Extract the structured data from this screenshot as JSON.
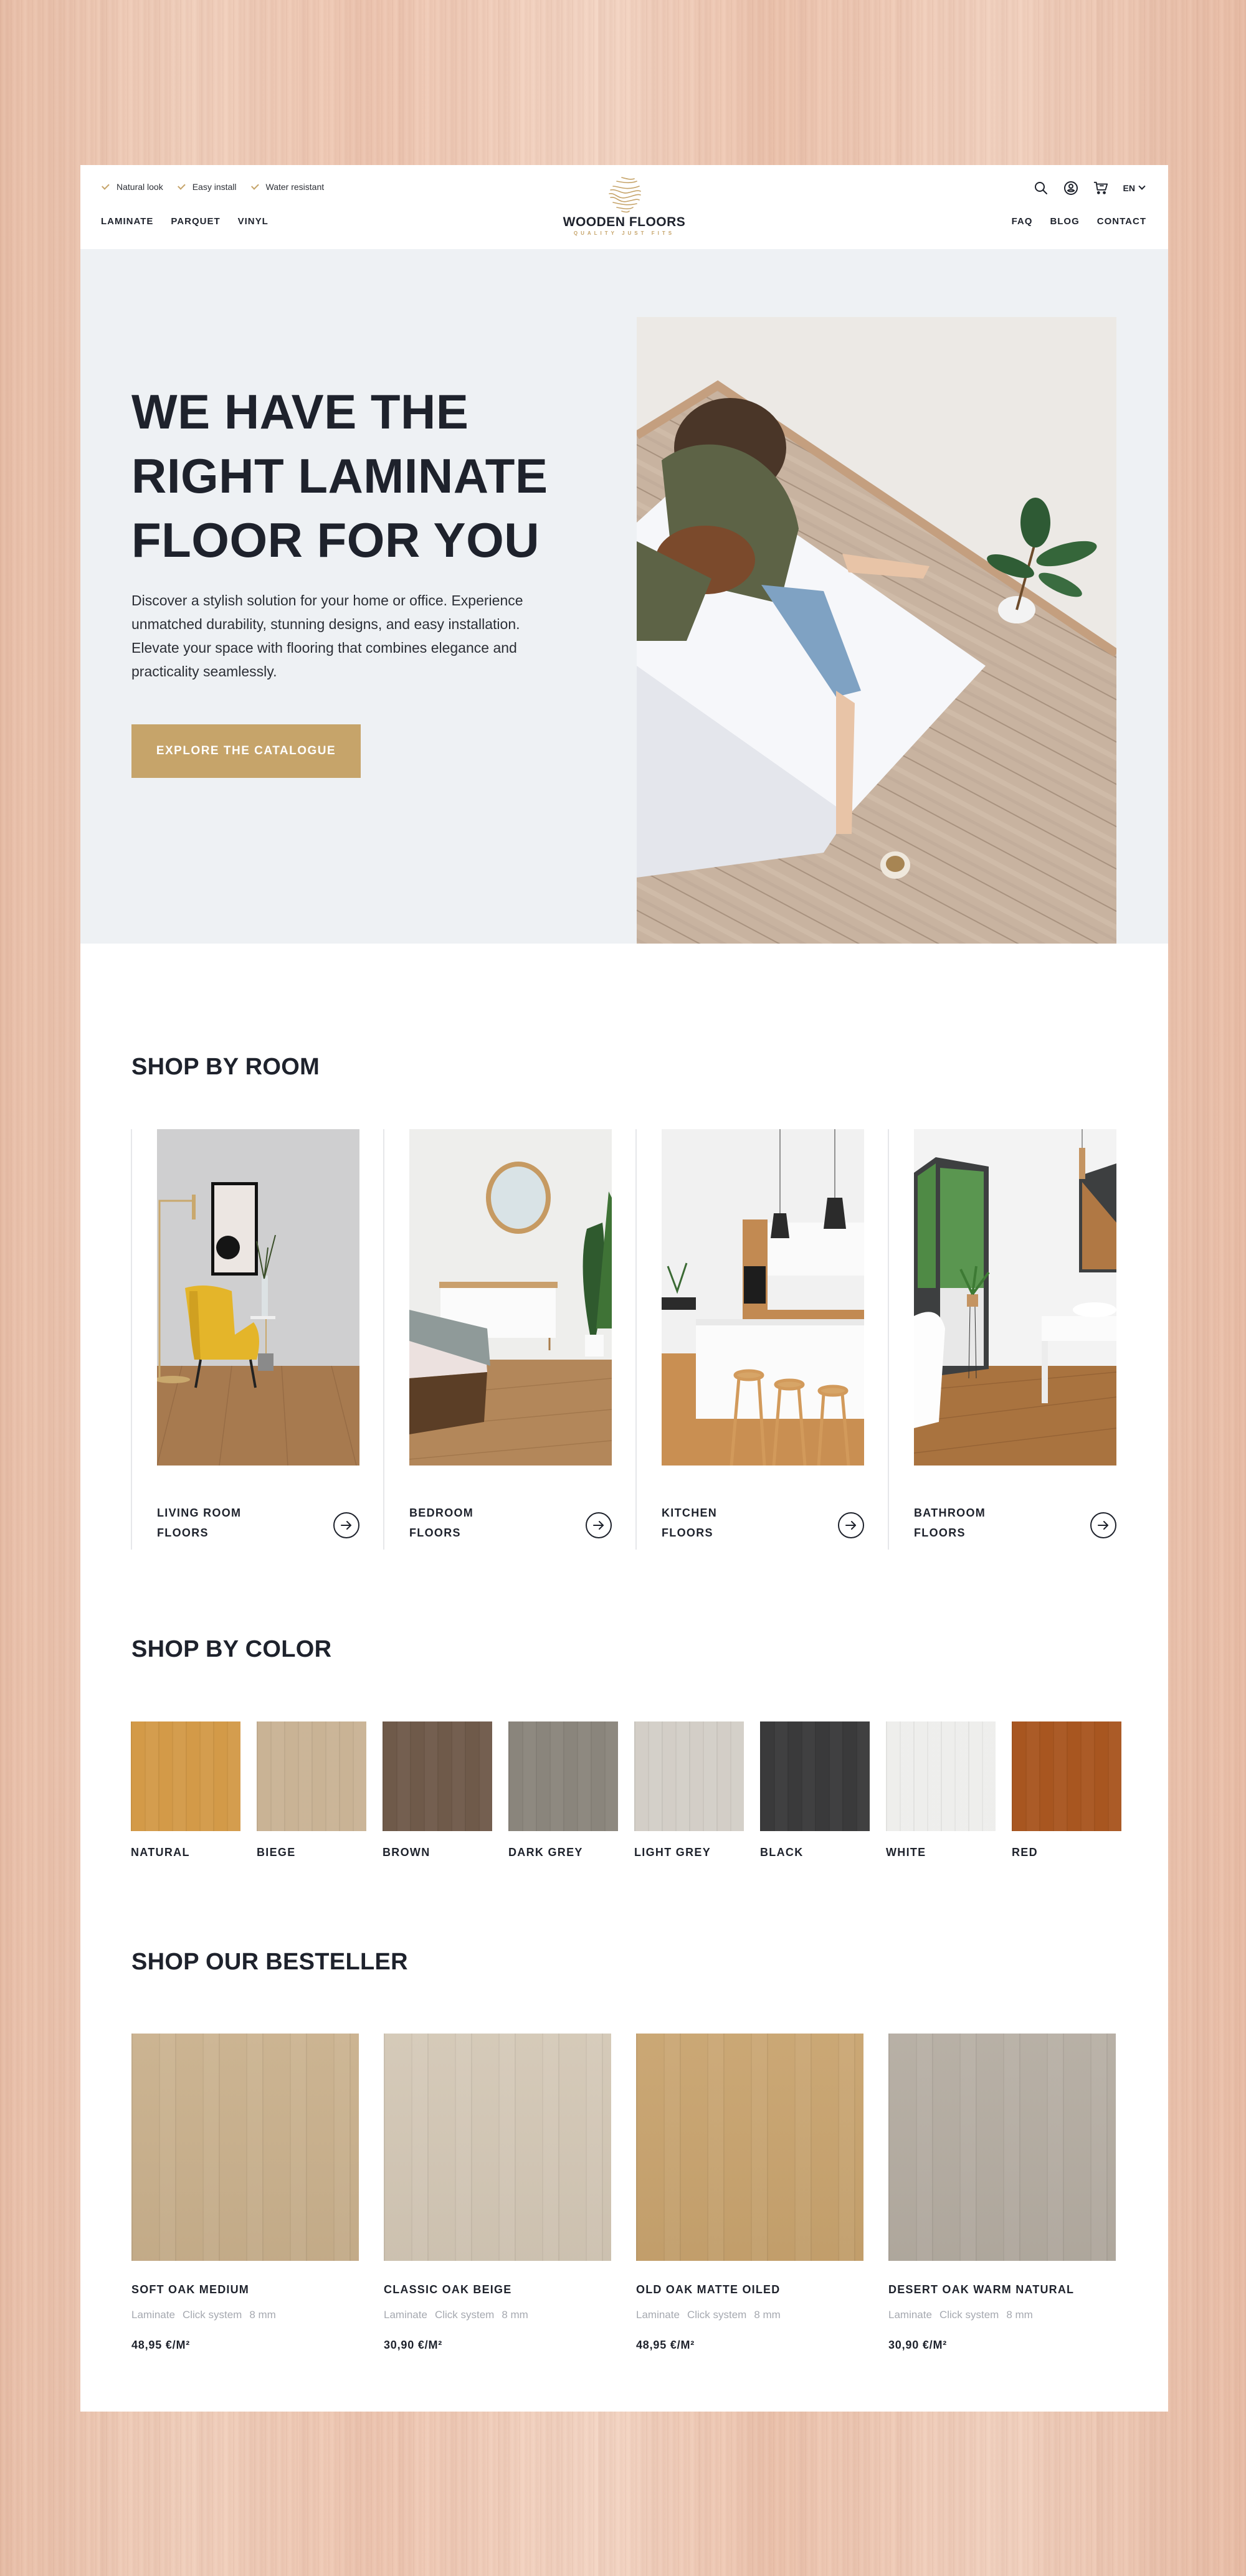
{
  "header": {
    "usps": [
      "Natural look",
      "Easy install",
      "Water resistant"
    ],
    "nav_left": [
      "LAMINATE",
      "PARQUET",
      "VINYL"
    ],
    "nav_right": [
      "FAQ",
      "BLOG",
      "CONTACT"
    ],
    "logo": {
      "name": "WOODEN FLOORS",
      "tagline": "QUALITY JUST FITS",
      "icon": "wood-grain-logo-icon"
    },
    "utility_icons": [
      "search-icon",
      "account-icon",
      "cart-icon"
    ],
    "language": "EN"
  },
  "hero": {
    "title": "WE HAVE THE RIGHT LAMINATE FLOOR FOR YOU",
    "description": "Discover a stylish solution for your home or office. Experience unmatched durability, stunning designs, and easy installation. Elevate your space with flooring that combines elegance and practicality seamlessly.",
    "cta_label": "EXPLORE THE CATALOGUE",
    "image_alt": "Two women relaxing on a mattress on a light wood laminate floor with a plant and coffee cup"
  },
  "shop_by_room": {
    "title": "SHOP BY ROOM",
    "rooms": [
      {
        "label": "LIVING ROOM\nFLOORS",
        "image_alt": "Living room with yellow armchair and framed art"
      },
      {
        "label": "BEDROOM\nFLOORS",
        "image_alt": "Bedroom with round mirror and dresser"
      },
      {
        "label": "KITCHEN\nFLOORS",
        "image_alt": "Kitchen with island and wooden stools"
      },
      {
        "label": "BATHROOM\nFLOORS",
        "image_alt": "Bathroom with freestanding tub and large window"
      }
    ]
  },
  "shop_by_color": {
    "title": "SHOP BY COLOR",
    "colors": [
      {
        "label": "NATURAL",
        "hex": "#d39a48"
      },
      {
        "label": "BIEGE",
        "hex": "#c9b395"
      },
      {
        "label": "BROWN",
        "hex": "#6f5a4a"
      },
      {
        "label": "DARK GREY",
        "hex": "#8a857c"
      },
      {
        "label": "LIGHT GREY",
        "hex": "#d3cec7"
      },
      {
        "label": "BLACK",
        "hex": "#3a3a3b"
      },
      {
        "label": "WHITE",
        "hex": "#eeeeec"
      },
      {
        "label": "RED",
        "hex": "#a85620"
      }
    ]
  },
  "bestseller": {
    "title": "SHOP OUR BESTELLER",
    "products": [
      {
        "name": "SOFT OAK MEDIUM",
        "meta": [
          "Laminate",
          "Click system",
          "8 mm"
        ],
        "price": "48,95 €/M²",
        "hex": "#c9b08c"
      },
      {
        "name": "CLASSIC OAK BEIGE",
        "meta": [
          "Laminate",
          "Click system",
          "8 mm"
        ],
        "price": "30,90 €/M²",
        "hex": "#d3c7b5"
      },
      {
        "name": "OLD OAK MATTE OILED",
        "meta": [
          "Laminate",
          "Click system",
          "8 mm"
        ],
        "price": "48,95 €/M²",
        "hex": "#c8a36e"
      },
      {
        "name": "DESERT OAK WARM NATURAL",
        "meta": [
          "Laminate",
          "Click system",
          "8 mm"
        ],
        "price": "30,90 €/M²",
        "hex": "#b4aca1"
      }
    ]
  },
  "colors": {
    "accent": "#c6a46a",
    "text": "#1e222c",
    "muted": "#a6a9b0",
    "hero_bg": "#eef1f4"
  }
}
